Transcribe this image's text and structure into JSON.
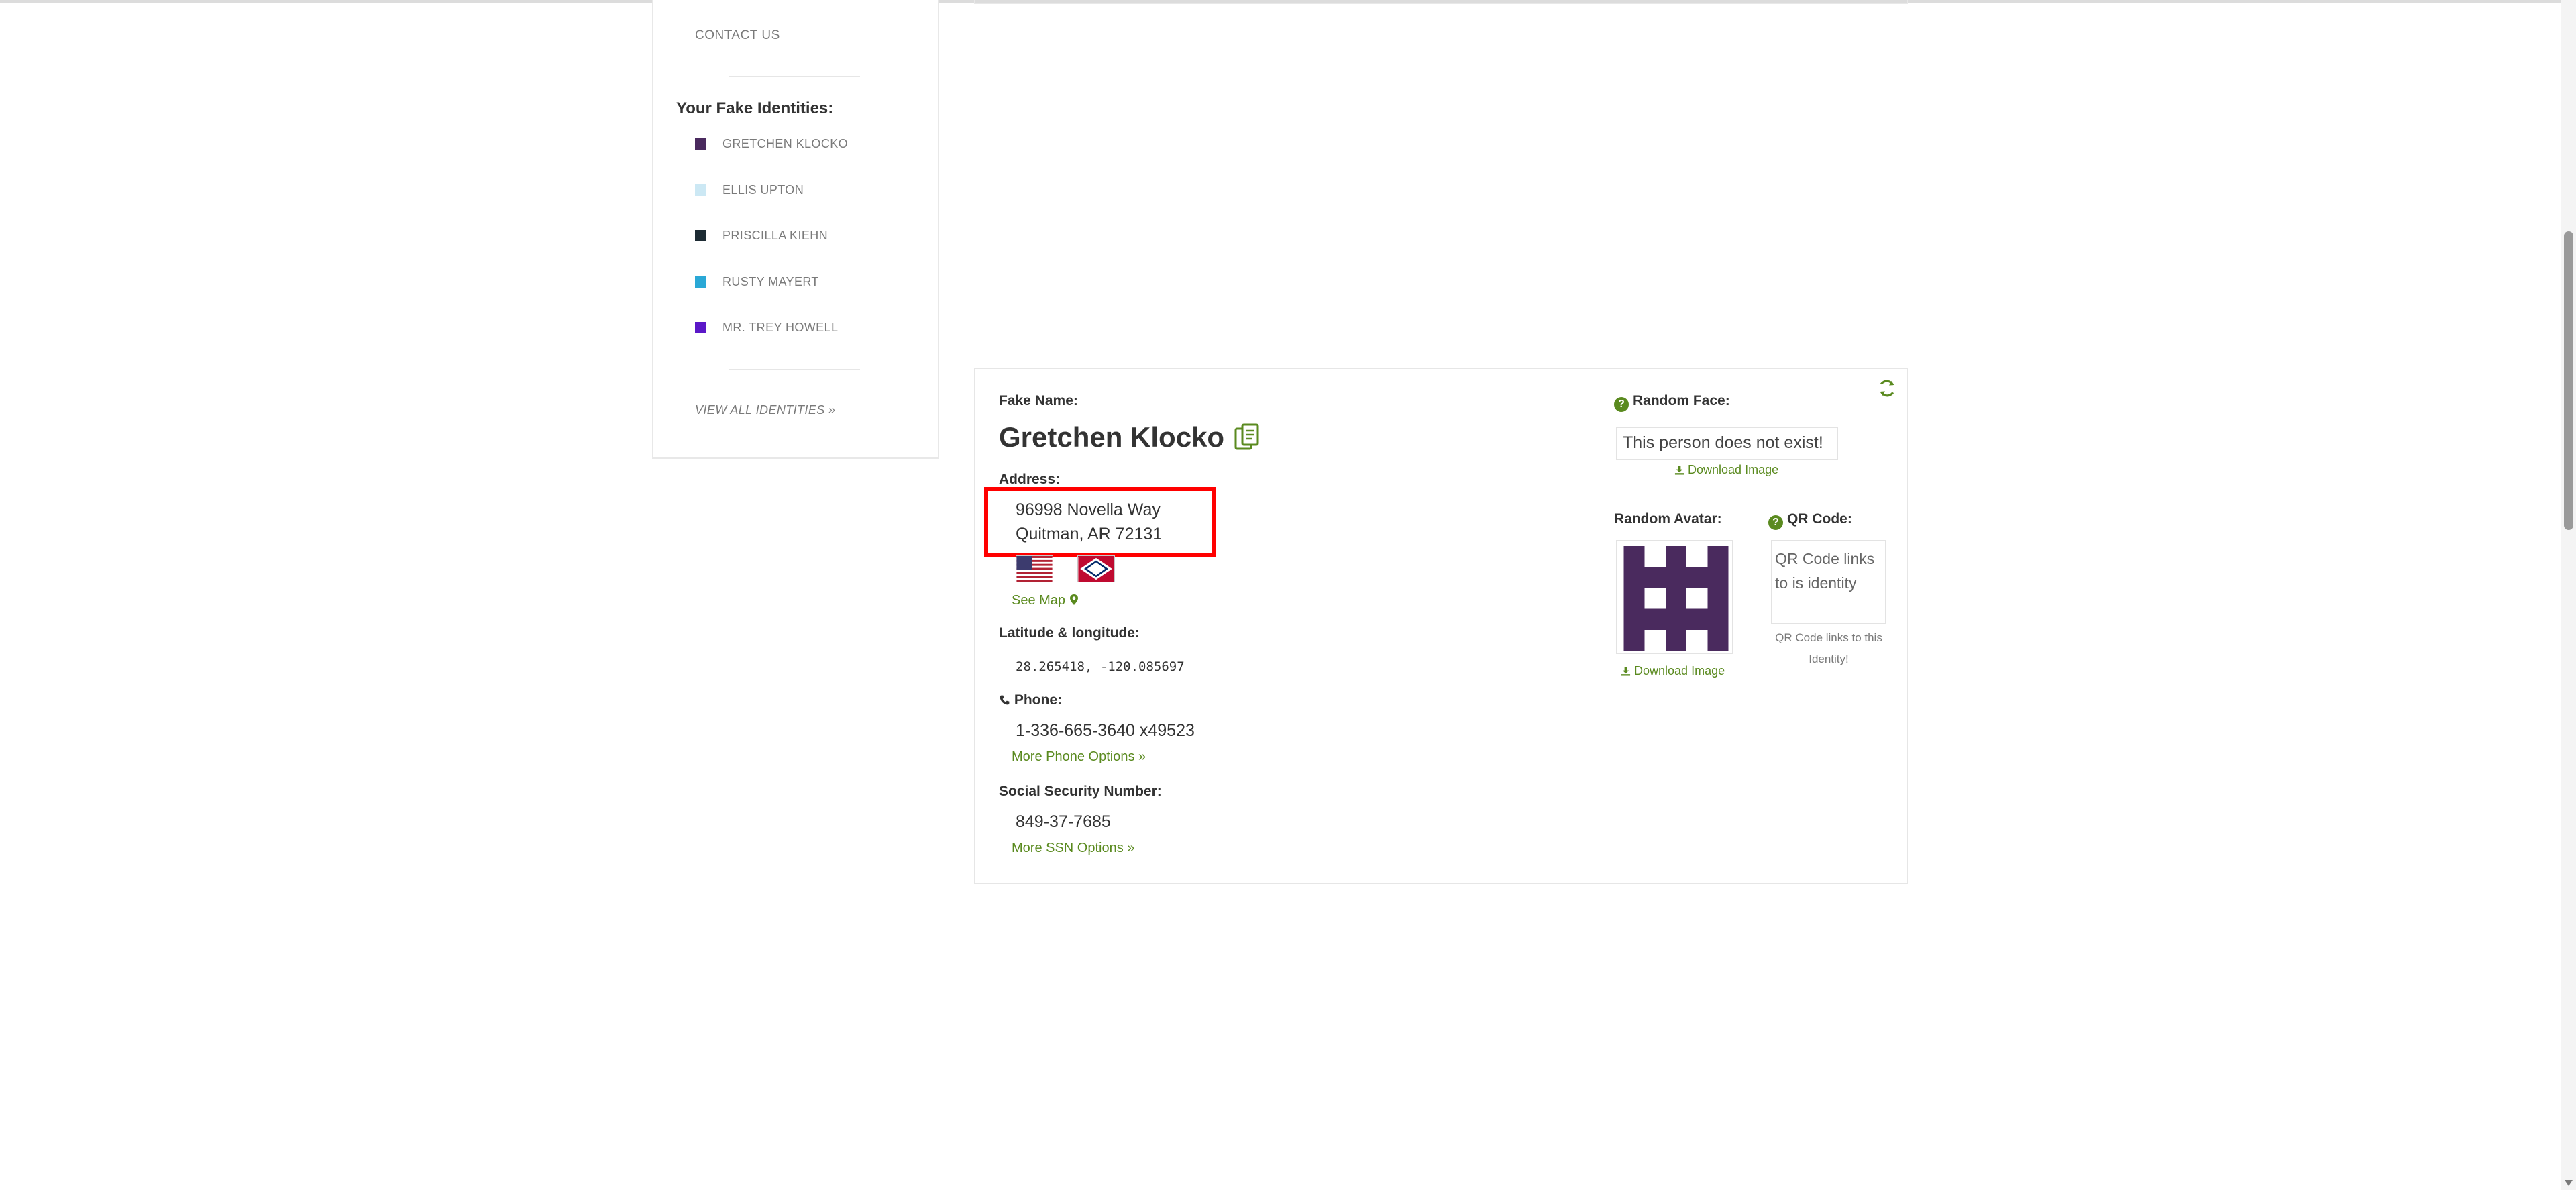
{
  "sidebar": {
    "contact_label": "CONTACT US",
    "identities_heading": "Your Fake Identities:",
    "identities": [
      {
        "name": "GRETCHEN KLOCKO",
        "color": "#4a2a5e"
      },
      {
        "name": "ELLIS UPTON",
        "color": "#cce8f4"
      },
      {
        "name": "PRISCILLA KIEHN",
        "color": "#1d2b33"
      },
      {
        "name": "RUSTY MAYERT",
        "color": "#2aa8d6"
      },
      {
        "name": "MR. TREY HOWELL",
        "color": "#5b18c8"
      }
    ],
    "view_all_label": "VIEW ALL IDENTITIES »"
  },
  "identity": {
    "fake_name_label": "Fake Name:",
    "name": "Gretchen Klocko",
    "address_label": "Address:",
    "address_line1": "96998 Novella Way",
    "address_line2": "Quitman, AR 72131",
    "see_map_label": "See Map",
    "latlong_label": "Latitude & longitude:",
    "latlong_value": "28.265418, -120.085697",
    "phone_label": "Phone:",
    "phone_value": "1-336-665-3640 x49523",
    "more_phone_label": "More Phone Options »",
    "ssn_label": "Social Security Number:",
    "ssn_value": "849-37-7685",
    "more_ssn_label": "More SSN Options »"
  },
  "media": {
    "random_face_label": "Random Face:",
    "face_alt_text": "This person does not exist!",
    "download_image_label": "Download Image",
    "random_avatar_label": "Random Avatar:",
    "avatar_color": "#4a2a5e",
    "avatar_download_label": "Download Image",
    "qr_code_label": "QR Code:",
    "qr_alt_text": "QR Code links to is identity",
    "qr_caption": "QR Code links to this Identity!"
  },
  "colors": {
    "accent_green": "#5a8a1f",
    "highlight_red": "#ff0000"
  },
  "icons": [
    "copy-icon",
    "refresh-icon",
    "help-icon",
    "download-icon",
    "map-marker-icon",
    "phone-icon",
    "us-flag-icon",
    "arkansas-flag-icon"
  ]
}
